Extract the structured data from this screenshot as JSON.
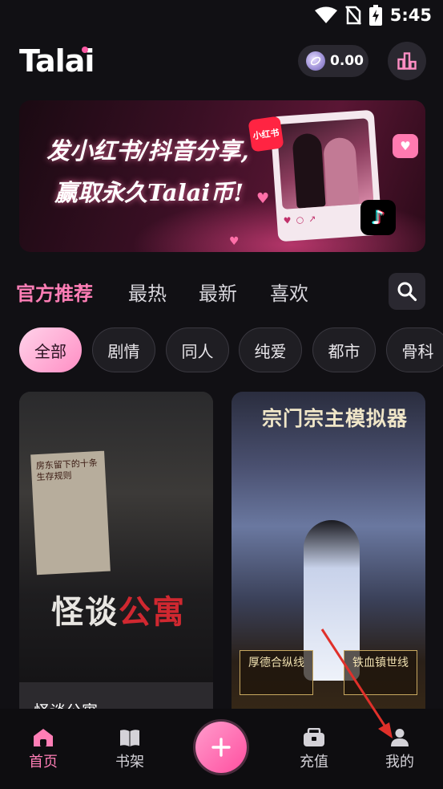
{
  "status_bar": {
    "time": "5:45"
  },
  "header": {
    "logo": "Talai",
    "coin_balance": "0.00"
  },
  "banner": {
    "line1": "发小红书/抖音分享,",
    "line2": "赢取永久Talai币!",
    "xhs_label": "小红书"
  },
  "tabs": [
    {
      "label": "官方推荐",
      "active": true
    },
    {
      "label": "最热",
      "active": false
    },
    {
      "label": "最新",
      "active": false
    },
    {
      "label": "喜欢",
      "active": false
    }
  ],
  "chips": [
    {
      "label": "全部",
      "active": true
    },
    {
      "label": "剧情",
      "active": false
    },
    {
      "label": "同人",
      "active": false
    },
    {
      "label": "纯爱",
      "active": false
    },
    {
      "label": "都市",
      "active": false
    },
    {
      "label": "骨科",
      "active": false
    }
  ],
  "cards": [
    {
      "art_title_a": "怪谈",
      "art_title_b": "公寓",
      "note_text": "房东留下的十条生存规则",
      "caption": "怪谈公寓"
    },
    {
      "art_title": "宗门宗主模拟器",
      "plaque_left": "厚德合纵线",
      "plaque_right": "铁血镇世线"
    }
  ],
  "bottom_nav": {
    "home": "首页",
    "bookshelf": "书架",
    "recharge": "充值",
    "mine": "我的"
  },
  "colors": {
    "accent": "#ff7eb6",
    "background": "#111014",
    "annotation_arrow": "#e0302a"
  }
}
